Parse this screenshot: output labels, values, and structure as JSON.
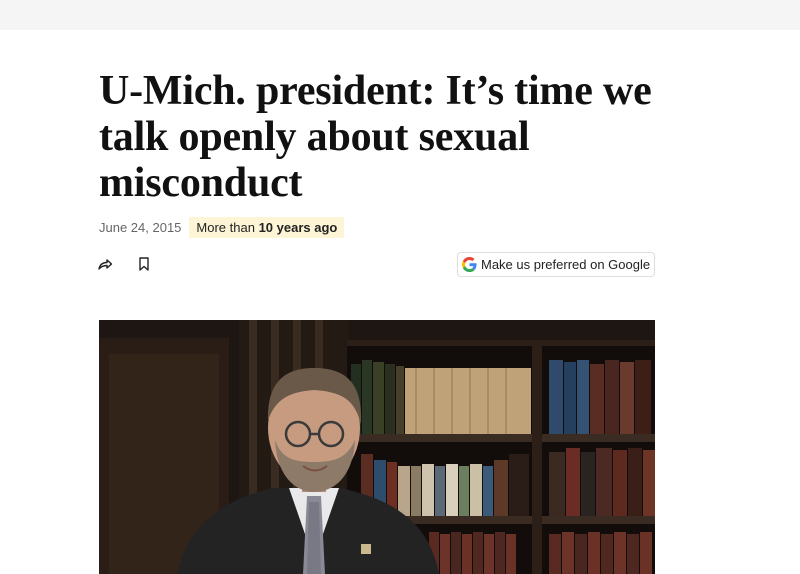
{
  "article": {
    "headline": "U-Mich. president: It’s time we talk openly about sexual misconduct",
    "date": "June 24, 2015",
    "age_prefix": "More than",
    "age_emphasis": "10 years ago"
  },
  "actions": {
    "share_icon": "share-arrow-icon",
    "bookmark_icon": "bookmark-icon",
    "preferred_label": "Make us preferred on Google",
    "preferred_icon": "google-g-icon"
  },
  "hero_image": {
    "description_icon": "photo"
  }
}
